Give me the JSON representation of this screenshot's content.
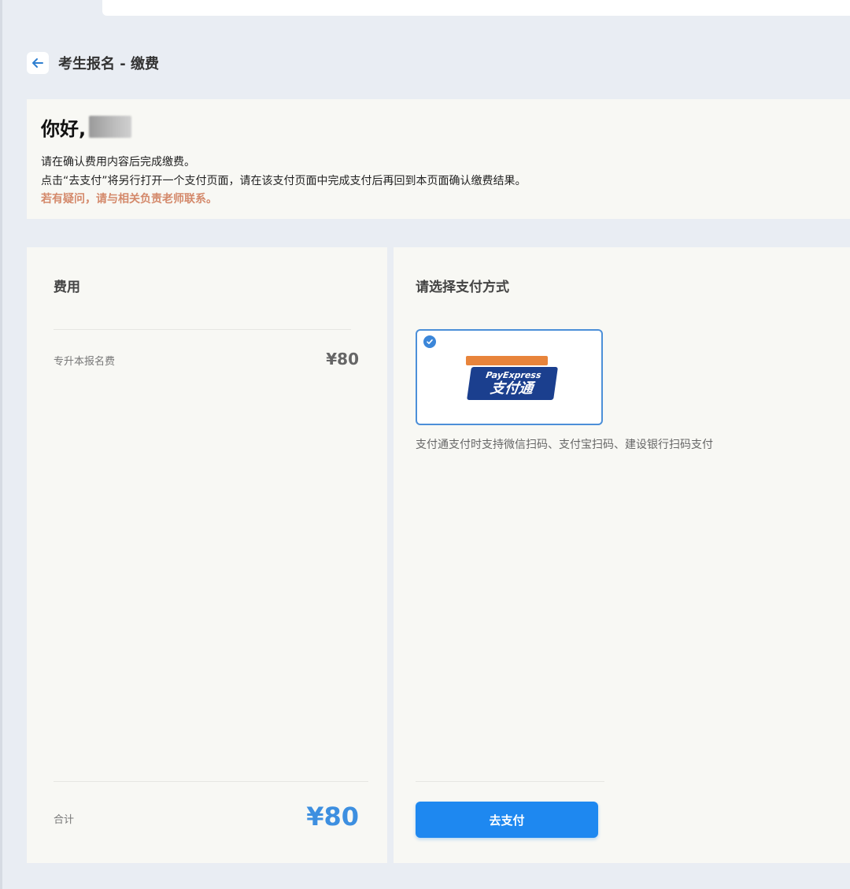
{
  "header": {
    "title": "考生报名 - 缴费"
  },
  "greeting": {
    "hello": "你好,",
    "info_lines": [
      "请在确认费用内容后完成缴费。",
      "点击“去支付”将另行打开一个支付页面，请在该支付页面中完成支付后再回到本页面确认缴费结果。"
    ],
    "warning": "若有疑问，请与相关负责老师联系。"
  },
  "fee": {
    "title": "费用",
    "items": [
      {
        "label": "专升本报名费",
        "amount": "¥80"
      }
    ],
    "total_label": "合计",
    "total_amount": "¥80"
  },
  "payment": {
    "title": "请选择支付方式",
    "method": {
      "logo_en": "PayExpress",
      "logo_cn": "支付通",
      "selected": true
    },
    "description": "支付通支付时支持微信扫码、支付宝扫码、建设银行扫码支付",
    "button_label": "去支付"
  },
  "colors": {
    "accent": "#1e88f0",
    "warning": "#d4896b",
    "total": "#3d8fe0"
  }
}
